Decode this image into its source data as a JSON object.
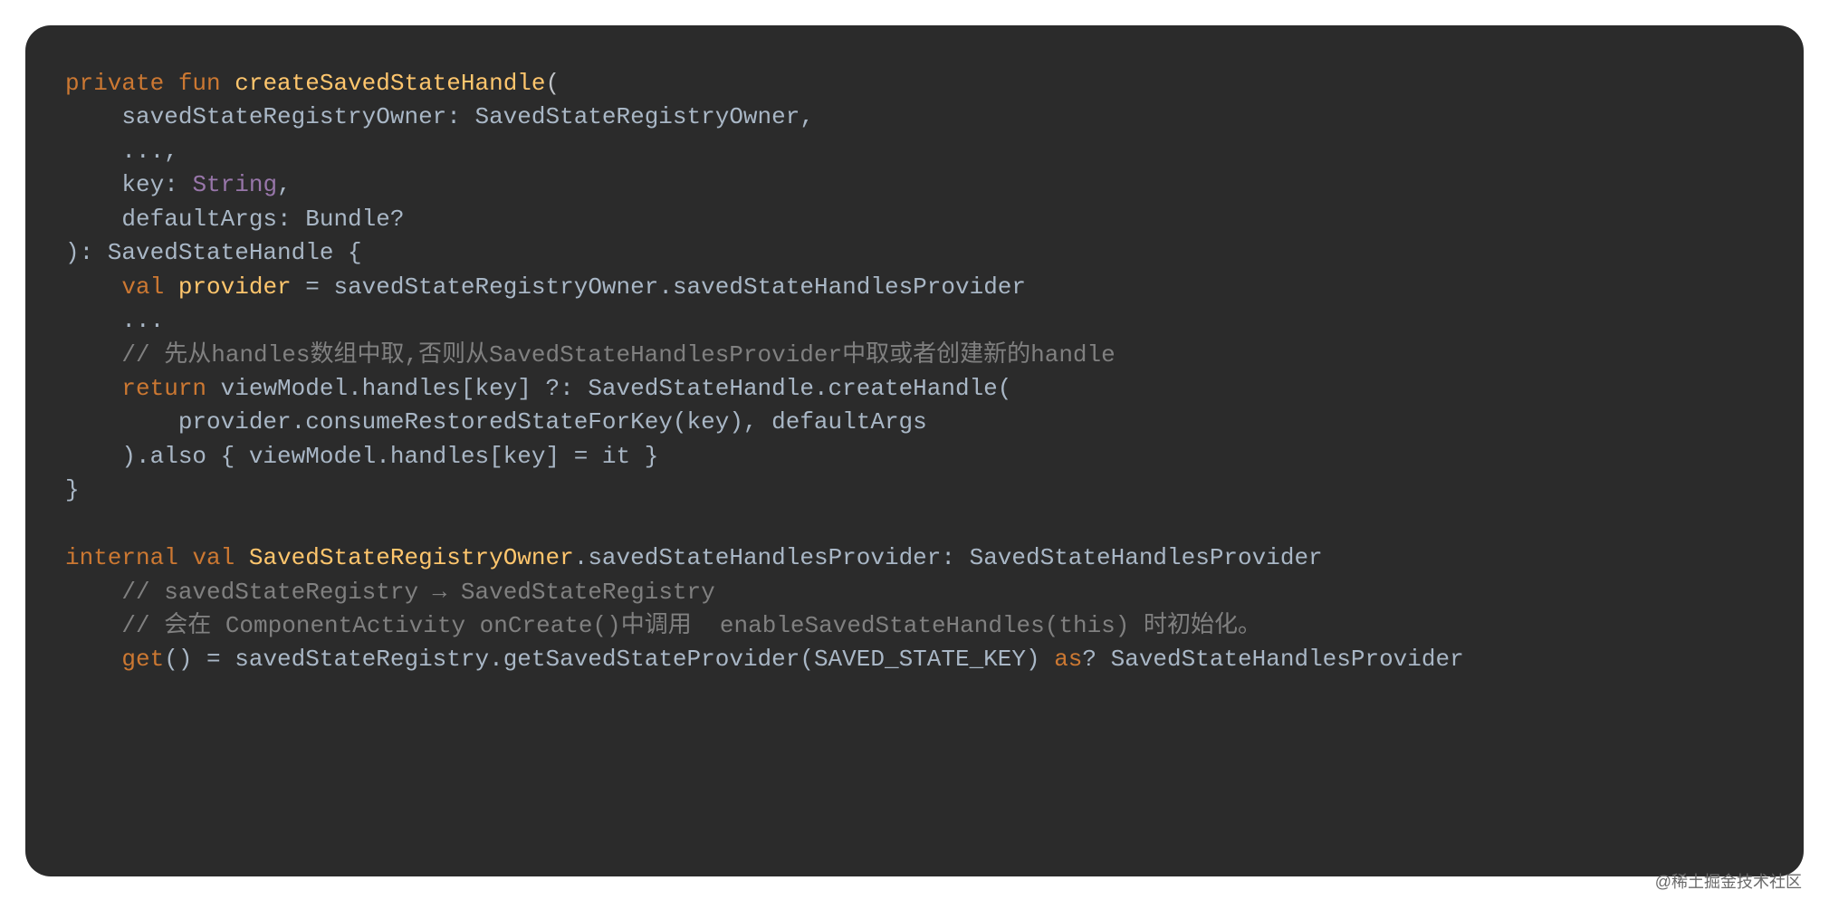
{
  "watermark": "@稀土掘金技术社区",
  "tokens": {
    "t0": "private",
    "t1": "fun",
    "t2": "createSavedStateHandle",
    "t3": "(",
    "t4": "    savedStateRegistryOwner: SavedStateRegistryOwner,",
    "t5": "    ...,",
    "t6": "    key: ",
    "t7": "String",
    "t8": ",",
    "t9": "    defaultArgs: Bundle?",
    "t10": "): SavedStateHandle {",
    "t11": "    ",
    "t12": "val",
    "t13": " ",
    "t14": "provider",
    "t15": " = savedStateRegistryOwner.savedStateHandlesProvider",
    "t16": "    ...",
    "t17": "    ",
    "t18": "// 先从handles数组中取,否则从SavedStateHandlesProvider中取或者创建新的handle",
    "t19": "    ",
    "t20": "return",
    "t21": " viewModel.handles[key] ?: SavedStateHandle.createHandle(",
    "t22": "        provider.consumeRestoredStateForKey(key), defaultArgs",
    "t23": "    ).also { viewModel.handles[key] = it }",
    "t24": "}",
    "t25": "",
    "t26": "internal",
    "t27": " ",
    "t28": "val",
    "t29": " ",
    "t30": "SavedStateRegistryOwner",
    "t31": ".savedStateHandlesProvider: SavedStateHandlesProvider",
    "t32": "    ",
    "t33": "// savedStateRegistry → SavedStateRegistry",
    "t34": "    ",
    "t35": "// 会在 ComponentActivity onCreate()中调用  enableSavedStateHandles(this) 时初始化。",
    "t36": "    ",
    "t37": "get",
    "t38": "() = savedStateRegistry.getSavedStateProvider(SAVED_STATE_KEY) ",
    "t39": "as",
    "t40": "? SavedStateHandlesProvider"
  }
}
